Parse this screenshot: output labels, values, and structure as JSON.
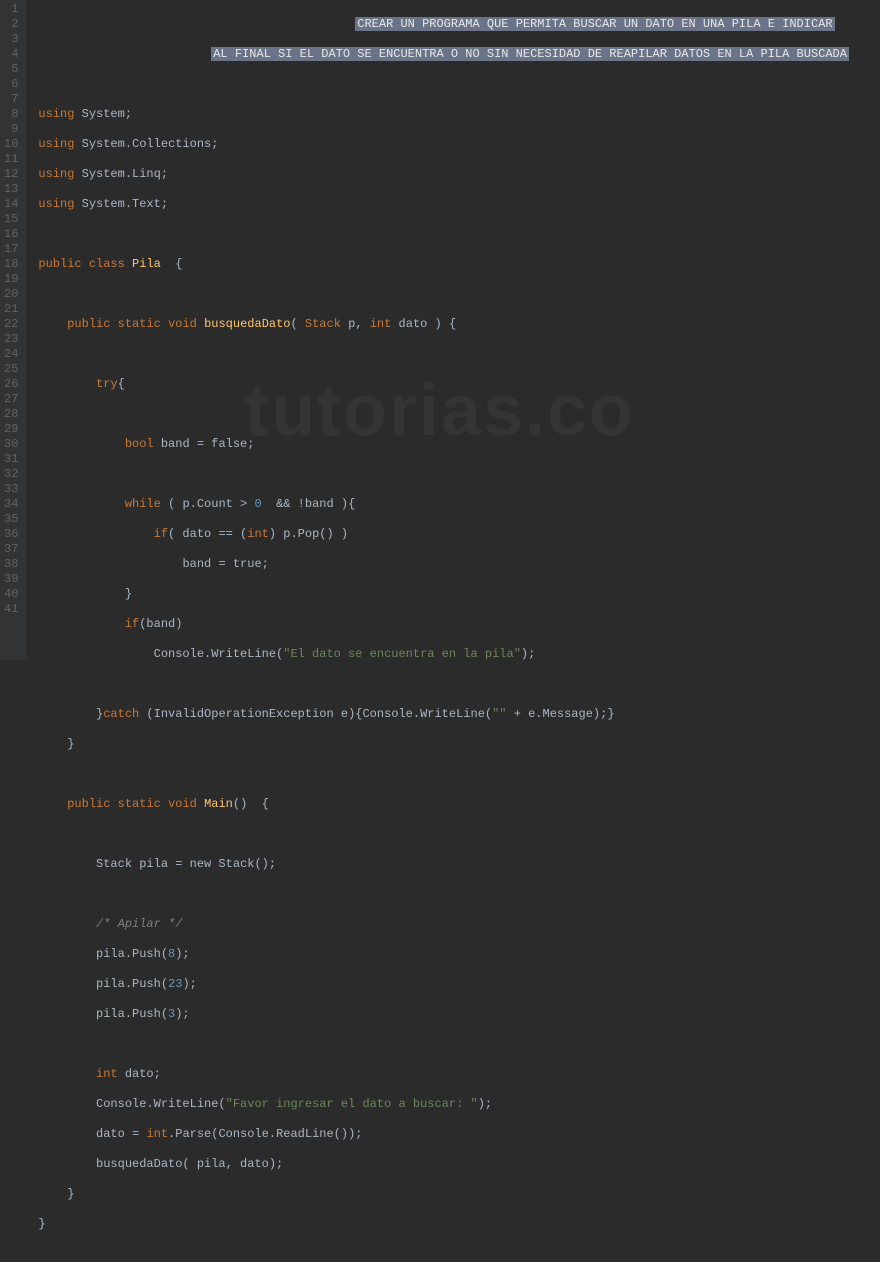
{
  "watermark": "tutorias.co",
  "lineCount": 41,
  "code": {
    "comment_header_1": "CREAR UN PROGRAMA QUE PERMITA BUSCAR UN DATO EN UNA PILA E INDICAR",
    "comment_header_2": "AL FINAL SI EL DATO SE ENCUENTRA O NO SIN NECESIDAD DE REAPILAR DATOS EN LA PILA BUSCADA",
    "using1_kw": "using",
    "using1_ns": "System;",
    "using2_kw": "using",
    "using2_ns": "System.Collections;",
    "using3_kw": "using",
    "using3_ns": "System.Linq;",
    "using4_kw": "using",
    "using4_ns": "System.Text;",
    "class_kw_public": "public",
    "class_kw_class": "class",
    "class_name": "Pila",
    "class_brace": "  {",
    "m1_public": "public",
    "m1_static": "static",
    "m1_void": "void",
    "m1_name": "busquedaDato",
    "m1_p1t": "Stack",
    "m1_p1n": " p, ",
    "m1_p2t": "int",
    "m1_p2n": " dato ) {",
    "try_kw": "try",
    "try_brace": "{",
    "bool_kw": "bool",
    "bool_rest": " band = false;",
    "while_kw": "while",
    "while_paren": " ( p.Count > ",
    "while_zero": "0",
    "while_and": "  && !band ){",
    "if1_kw": "if",
    "if1_paren": "( dato == (",
    "if1_cast": "int",
    "if1_rest": ") p.Pop() )",
    "band_true": "band = true;",
    "close_brace1": "}",
    "if2_kw": "if",
    "if2_cond": "(band)",
    "cw1_pre": "Console.WriteLine(",
    "cw1_str": "\"El dato se encuentra en la pila\"",
    "cw1_post": ");",
    "catch_close": "}",
    "catch_kw": "catch",
    "catch_rest1": " (InvalidOperationException e){Console.WriteLine(",
    "catch_str": "\"\"",
    "catch_rest2": " + e.Message);}",
    "close_brace2": "}",
    "m2_public": "public",
    "m2_static": "static",
    "m2_void": "void",
    "m2_name": "Main",
    "m2_sig": "()  {",
    "stack_decl": "Stack pila = new Stack();",
    "cmt_apilar": "/* Apilar */",
    "push1_pre": "pila.Push(",
    "push1_n": "8",
    "push1_post": ");",
    "push2_pre": "pila.Push(",
    "push2_n": "23",
    "push2_post": ");",
    "push3_pre": "pila.Push(",
    "push3_n": "3",
    "push3_post": ");",
    "int_kw": "int",
    "int_rest": " dato;",
    "cw2_pre": "Console.WriteLine(",
    "cw2_str": "\"Favor ingresar el dato a buscar: \"",
    "cw2_post": ");",
    "parse_pre": "dato = ",
    "parse_int": "int",
    "parse_rest": ".Parse(Console.ReadLine());",
    "call": "busquedaDato( pila, dato);",
    "close_brace3": "}",
    "close_brace4": "}"
  }
}
